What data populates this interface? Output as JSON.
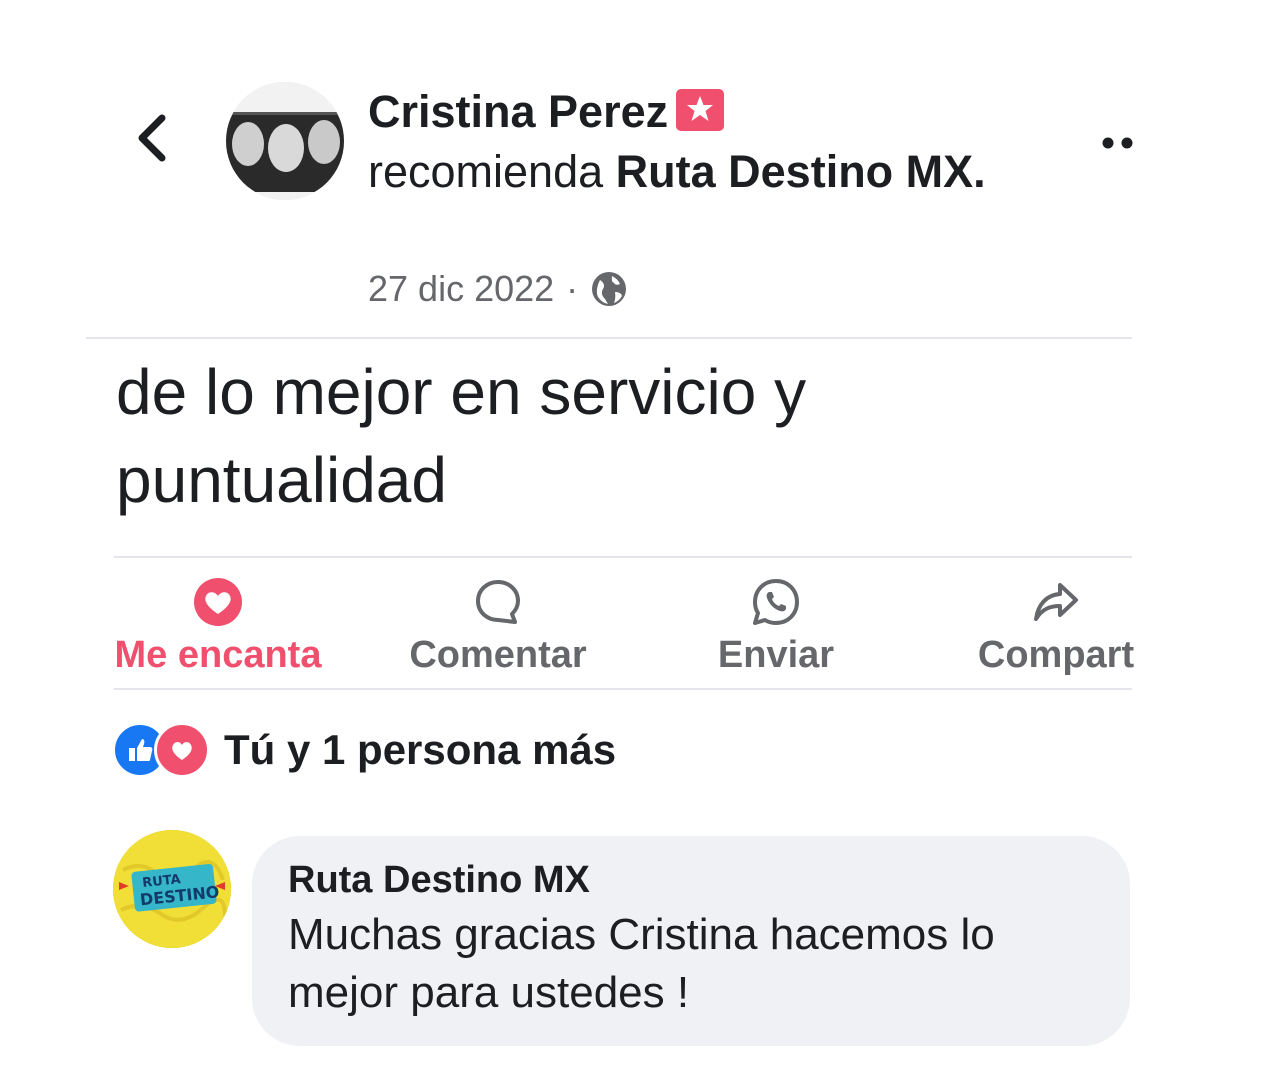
{
  "post": {
    "author": "Cristina Perez",
    "recommends_text": "recomienda",
    "page_name": "Ruta Destino MX.",
    "timestamp": "27 dic 2022",
    "separator": "·",
    "body_line1": "de lo mejor en servicio y",
    "body_line2": "puntualidad"
  },
  "actions": {
    "love_label": "Me encanta",
    "comment_label": "Comentar",
    "send_label": "Enviar",
    "share_label": "Compart"
  },
  "reactions": {
    "summary": "Tú y 1 persona más"
  },
  "comment": {
    "author": "Ruta Destino MX",
    "text_line1": "Muchas gracias Cristina hacemos lo",
    "text_line2": "mejor para ustedes !",
    "avatar_logo_line1": "RUTA",
    "avatar_logo_line2": "DESTINO"
  },
  "colors": {
    "love": "#f0506e",
    "like": "#1877f2",
    "muted": "#65676b",
    "bubble": "#eff1f4"
  },
  "icons": [
    "back-arrow-icon",
    "star-badge-icon",
    "globe-icon",
    "more-icon",
    "heart-icon",
    "comment-icon",
    "whatsapp-icon",
    "share-icon",
    "like-reaction-icon",
    "love-reaction-icon"
  ]
}
